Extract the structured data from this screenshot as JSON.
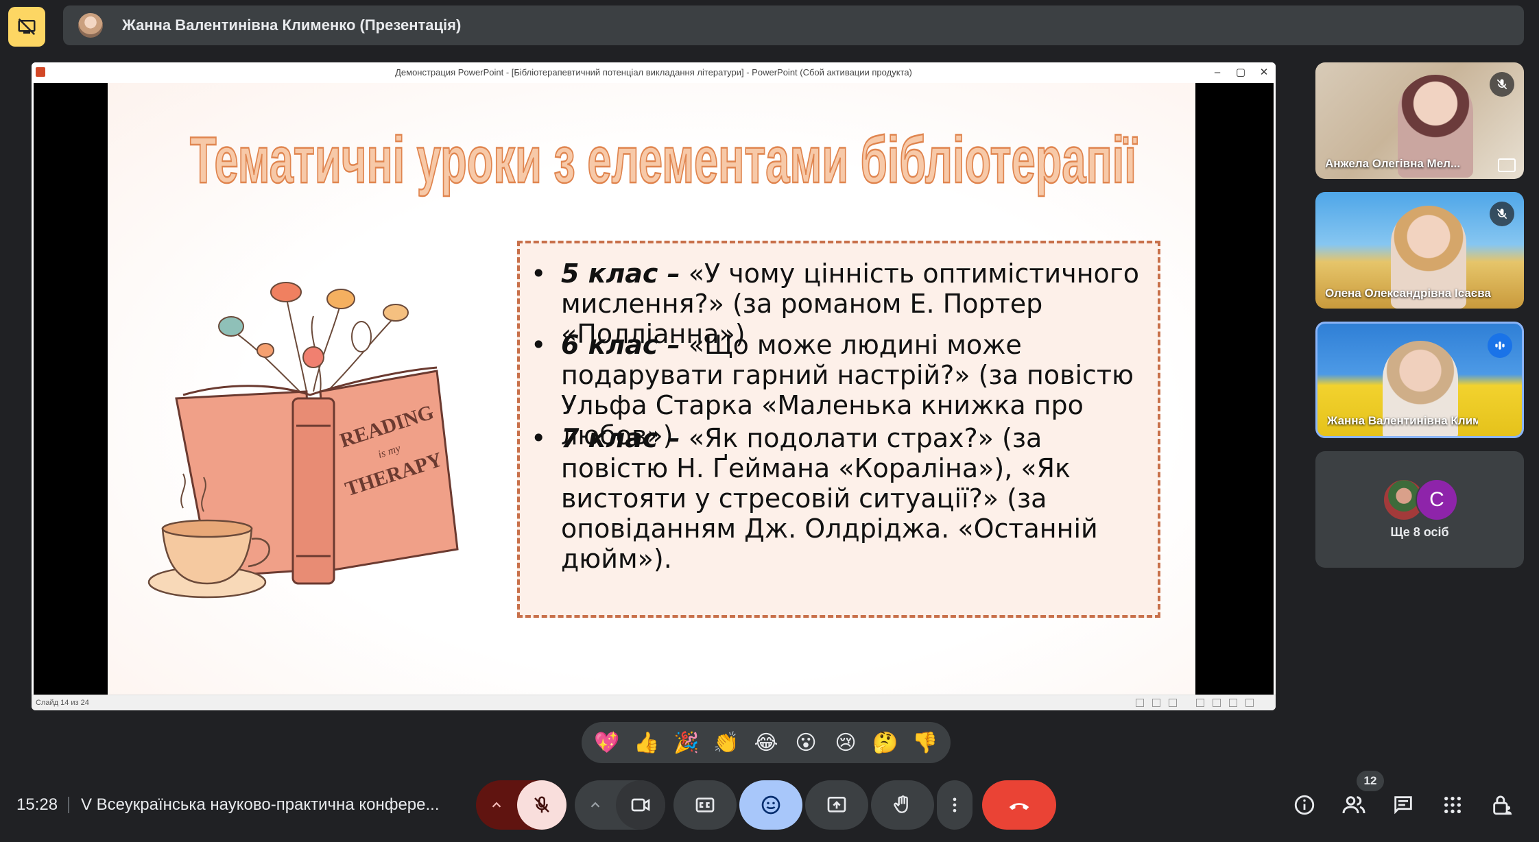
{
  "presenter": {
    "title": "Жанна Валентинівна Клименко (Презентація)"
  },
  "ppt": {
    "window_title": "Демонстрация PowerPoint - [Бібліотерапевтичний потенціал викладання літератури] - PowerPoint (Сбой активации продукта)",
    "status": "Слайд 14 из 24"
  },
  "slide": {
    "title": "Тематичні уроки з елементами бібліотерапії",
    "illustration_text_1": "READING",
    "illustration_text_2": "is my",
    "illustration_text_3": "THERAPY",
    "bullets": [
      {
        "grade": "5 клас –",
        "text": " «У чому цінність оптимістичного мислення?» (за романом Е. Портер «Полліанна»)"
      },
      {
        "grade": "6 клас –",
        "text": " «Що може людині може подарувати гарний настрій?» (за повістю Ульфа Старка «Маленька книжка про любов»)"
      },
      {
        "grade": "7 клас –",
        "text": " «Як подолати страх?» (за повістю Н. Ґеймана «Кораліна»), «Як вистояти у стресовій ситуації?» (за оповіданням Дж. Олдріджа. «Останній дюйм»)."
      }
    ]
  },
  "participants": [
    {
      "name": "Анжела Олегівна Мел...",
      "muted": true
    },
    {
      "name": "Олена Олександрівна Ісаєва",
      "muted": true
    },
    {
      "name": "Жанна Валентинівна Климе...",
      "muted": false,
      "speaking": true
    }
  ],
  "more_tile": {
    "avatar_letter": "C",
    "label": "Ще 8 осіб"
  },
  "reactions": [
    "💖",
    "👍",
    "🎉",
    "👏",
    "😂",
    "😮",
    "😢",
    "🤔",
    "👎"
  ],
  "bottom": {
    "time": "15:28",
    "meeting_title": "V Всеукраїнська науково-практична конфере...",
    "people_count": "12"
  },
  "colors": {
    "present_yellow": "#fdd663",
    "hangup_red": "#ea4335",
    "reactions_active": "#a8c7fa",
    "mic_off_bg": "#f9dedc",
    "slide_title_orange": "#f0a070",
    "box_border": "#c8704a"
  }
}
